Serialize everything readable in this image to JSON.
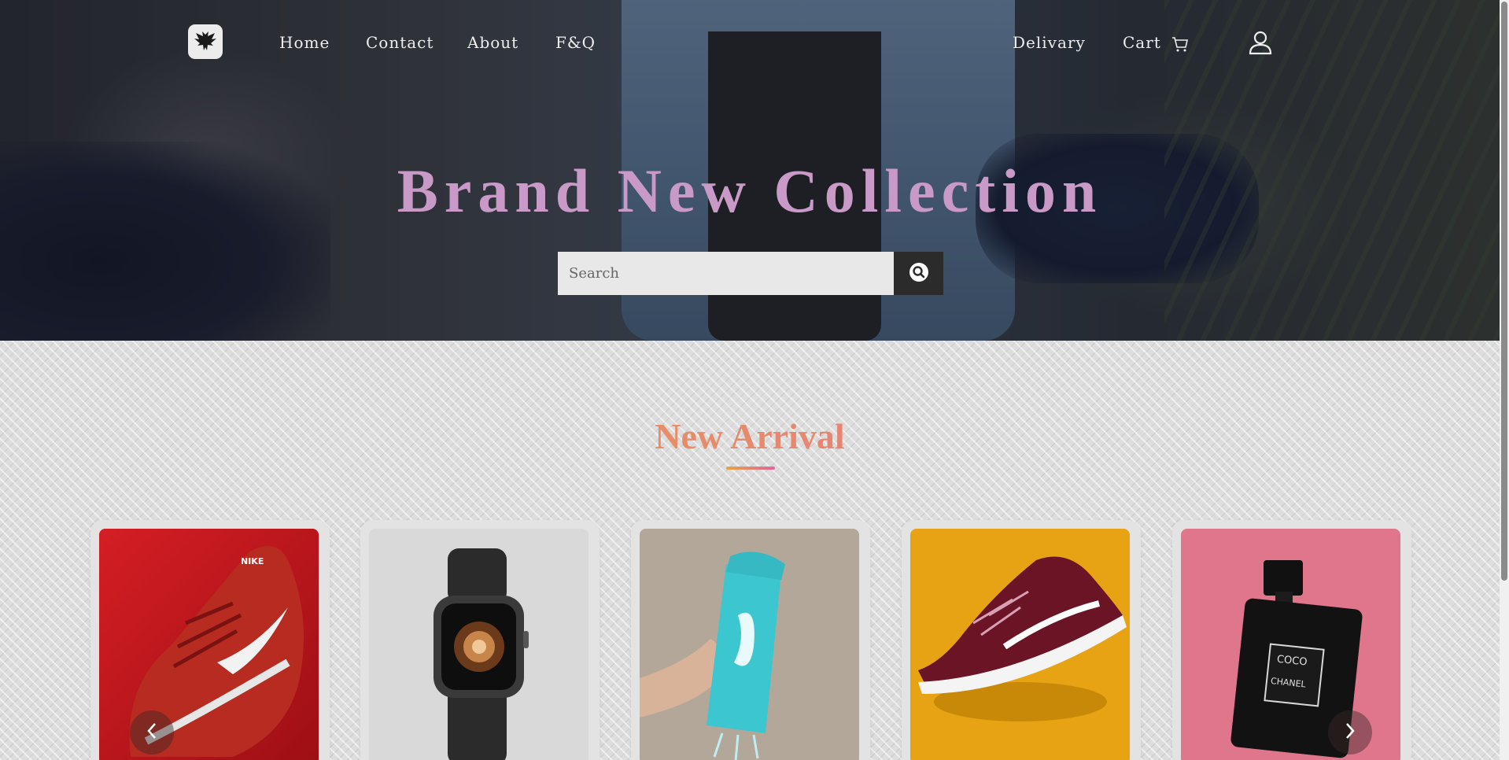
{
  "nav": {
    "logo_icon": "eagle-logo-icon",
    "links_left": [
      "Home",
      "Contact",
      "About",
      "F&Q"
    ],
    "delivery": "Delivary",
    "cart": "Cart",
    "cart_icon": "cart-icon",
    "user_icon": "user-icon"
  },
  "hero": {
    "title": "Brand New Collection",
    "search_placeholder": "Search",
    "search_icon": "search-icon"
  },
  "section": {
    "title": "New Arrival"
  },
  "products": [
    {
      "image": "red-sneaker"
    },
    {
      "image": "smartwatch"
    },
    {
      "image": "shaker-bottle"
    },
    {
      "image": "maroon-sneaker"
    },
    {
      "image": "perfume-bottle"
    }
  ],
  "carousel": {
    "prev_icon": "chevron-left-icon",
    "next_icon": "chevron-right-icon"
  },
  "colors": {
    "hero_title": "#c99ac7",
    "accent_start": "#e6a53f",
    "accent_end": "#e264a0"
  }
}
